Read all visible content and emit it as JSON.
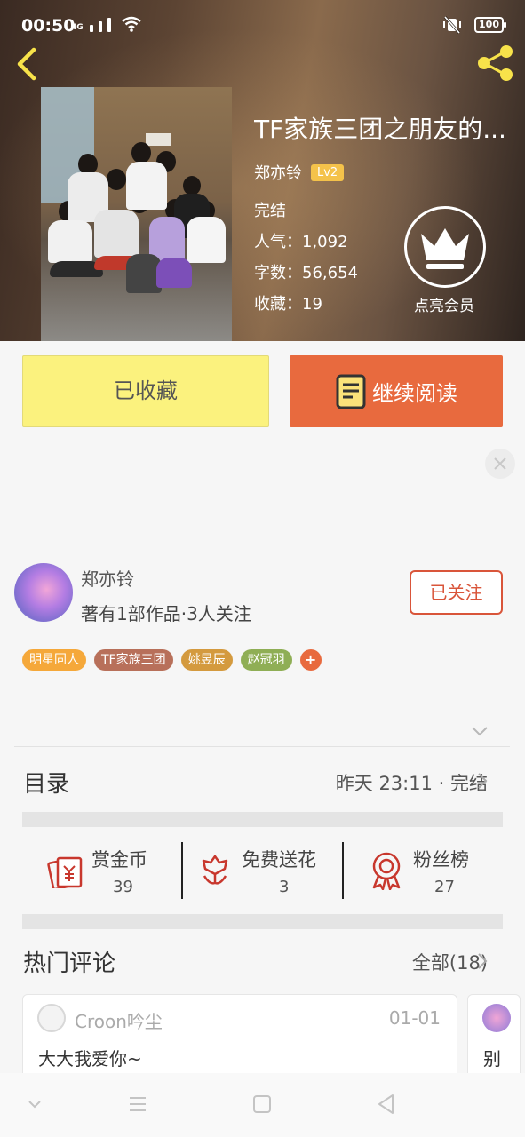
{
  "status_bar": {
    "time": "00:50",
    "network": "4G",
    "battery": "100"
  },
  "book": {
    "title": "TF家族三团之朋友的...",
    "author": "郑亦铃",
    "author_level": "Lv2",
    "status": "完结",
    "popularity": "人气：1,092",
    "word_count": "字数：56,654",
    "favorites": "收藏：19",
    "vip_label": "点亮会员"
  },
  "actions": {
    "collect_label": "已收藏",
    "read_label": "继续阅读"
  },
  "author_card": {
    "name": "郑亦铃",
    "description": "著有1部作品·3人关注",
    "follow_label": "已关注"
  },
  "tags": [
    {
      "label": "明星同人",
      "color": "#f5a83a"
    },
    {
      "label": "TF家族三团",
      "color": "#b8705a"
    },
    {
      "label": "姚昱辰",
      "color": "#d49a3e"
    },
    {
      "label": "赵冠羽",
      "color": "#8fae55"
    }
  ],
  "tag_more": "+",
  "catalog": {
    "title": "目录",
    "status": "昨天 23:11 · 完结"
  },
  "stats": [
    {
      "label": "赏金币",
      "value": "39",
      "icon": "red-envelope-icon"
    },
    {
      "label": "免费送花",
      "value": "3",
      "icon": "flower-icon"
    },
    {
      "label": "粉丝榜",
      "value": "27",
      "icon": "medal-icon"
    }
  ],
  "comments": {
    "title": "热门评论",
    "all_label": "全部(18)",
    "items": [
      {
        "user": "Croon吟尘",
        "date": "01-01",
        "text": "大大我爱你~"
      },
      {
        "user": "",
        "date": "",
        "text": "别"
      }
    ]
  },
  "colors": {
    "accent_orange": "#e86a3e",
    "collect_yellow": "#fbf27e",
    "follow_red": "#d9553a",
    "icon_red": "#c8372d",
    "level_badge": "#f4c24a",
    "share_yellow": "#f7e24a"
  }
}
